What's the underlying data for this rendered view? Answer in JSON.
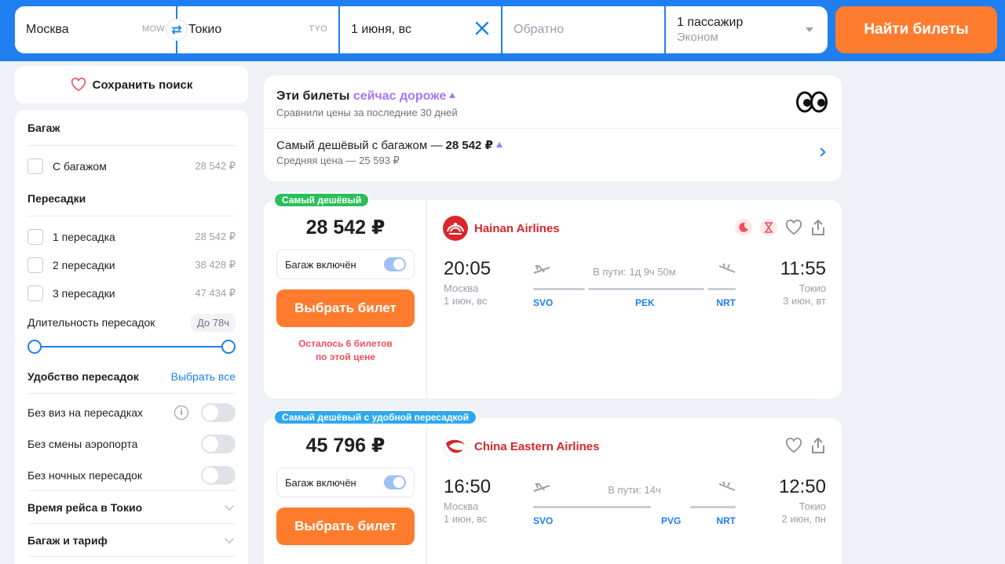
{
  "search": {
    "from_city": "Москва",
    "from_code": "MOW",
    "to_city": "Токио",
    "to_code": "TYO",
    "depart_date": "1 июня, вс",
    "return_placeholder": "Обратно",
    "passengers": "1 пассажир",
    "cabin": "Эконом",
    "find_label": "Найти билеты",
    "swap_glyph": "⇄"
  },
  "sidebar": {
    "save_search": "Сохранить поиск",
    "baggage": {
      "title": "Багаж",
      "items": [
        {
          "label": "С багажом",
          "price": "28 542 ₽"
        }
      ]
    },
    "stops": {
      "title": "Пересадки",
      "items": [
        {
          "label": "1 пересадка",
          "price": "28 542 ₽"
        },
        {
          "label": "2 пересадки",
          "price": "38 428 ₽"
        },
        {
          "label": "3 пересадки",
          "price": "47 434 ₽"
        }
      ]
    },
    "layover": {
      "label": "Длительность пересадок",
      "value": "До 78ч"
    },
    "comfort": {
      "title": "Удобство пересадок",
      "select_all": "Выбрать все",
      "items": [
        {
          "label": "Без виз на пересадках",
          "info": "i"
        },
        {
          "label": "Без смены аэропорта"
        },
        {
          "label": "Без ночных пересадок"
        }
      ]
    },
    "accordions": [
      "Время рейса в Токио",
      "Багаж и тариф"
    ]
  },
  "trend": {
    "title_prefix": "Эти билеты ",
    "title_highlight": "сейчас дороже",
    "subtitle": "Сравнили цены за последние 30 дней",
    "cheapest_prefix": "Самый дешёвый с багажом — ",
    "cheapest_price": "28 542 ₽",
    "average": "Средняя цена — 25 593 ₽"
  },
  "tickets": [
    {
      "badge": "Самый дешёвый",
      "price": "28 542 ₽",
      "baggage": "Багаж включён",
      "choose": "Выбрать билет",
      "note_line1": "Осталось 6 билетов",
      "note_line2": "по этой цене",
      "airline": "Hainan Airlines",
      "dep_time": "20:05",
      "dep_city": "Москва",
      "dep_date": "1 июн, вс",
      "arr_time": "11:55",
      "arr_city": "Токио",
      "arr_date": "3 июн, вт",
      "duration": "В пути: 1д 9ч 50м",
      "codes": [
        "SVO",
        "PEK",
        "NRT"
      ]
    },
    {
      "badge": "Самый дешёвый с удобной пересадкой",
      "price": "45 796 ₽",
      "baggage": "Багаж включён",
      "choose": "Выбрать билет",
      "airline": "China Eastern Airlines",
      "dep_time": "16:50",
      "dep_city": "Москва",
      "dep_date": "1 июн, вс",
      "arr_time": "12:50",
      "arr_city": "Токио",
      "arr_date": "2 июн, пн",
      "duration": "В пути: 14ч",
      "codes": [
        "SVO",
        "PVG",
        "NRT"
      ]
    }
  ],
  "colors": {
    "brand_blue": "#1f7ff0",
    "accent_orange": "#ff7c2e",
    "trend_purple": "#a477f5",
    "badge_green": "#2bbf5b",
    "badge_blue": "#2da8f0",
    "airline_red": "#d9262b"
  }
}
